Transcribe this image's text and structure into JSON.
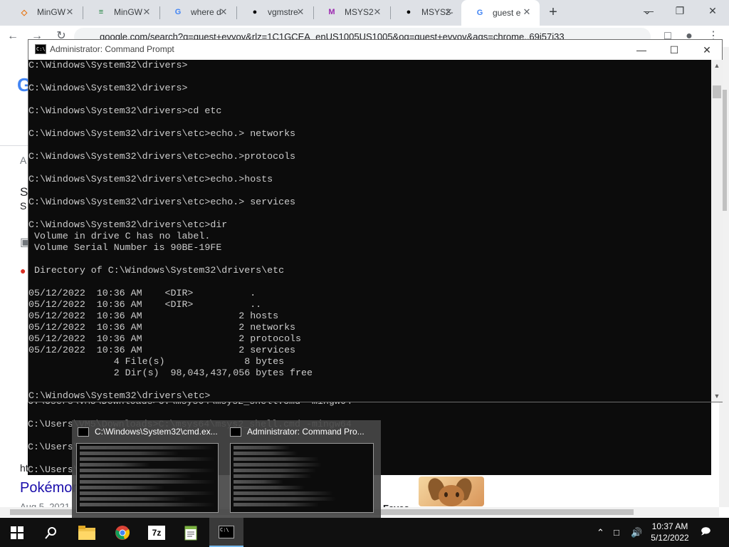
{
  "browser": {
    "tabs": [
      {
        "label": "MinGW",
        "icon": "sourceforge-icon",
        "color": "#e8710a"
      },
      {
        "label": "MinGW",
        "icon": "mingw-icon",
        "color": "#188038"
      },
      {
        "label": "where d",
        "icon": "google-icon",
        "color": "#4285f4"
      },
      {
        "label": "vgmstre",
        "icon": "github-icon",
        "color": "#000000"
      },
      {
        "label": "MSYS2",
        "icon": "msys2-icon",
        "color": "#9c27b0"
      },
      {
        "label": "MSYS2-",
        "icon": "github-icon",
        "color": "#000000"
      },
      {
        "label": "guest e",
        "icon": "google-icon",
        "color": "#4285f4",
        "active": true
      }
    ],
    "new_tab": "+",
    "url": "google.com/search?q=guest+evyov&rlz=1C1GCEA_enUS1005US1005&oq=guest+evyov&aqs=chrome..69i57j33"
  },
  "cmd_window": {
    "title": "Administrator: Command Prompt",
    "lines": [
      "C:\\Windows\\System32\\drivers>",
      "",
      "C:\\Windows\\System32\\drivers>",
      "",
      "C:\\Windows\\System32\\drivers>cd etc",
      "",
      "C:\\Windows\\System32\\drivers\\etc>echo.> networks",
      "",
      "C:\\Windows\\System32\\drivers\\etc>echo.>protocols",
      "",
      "C:\\Windows\\System32\\drivers\\etc>echo.>hosts",
      "",
      "C:\\Windows\\System32\\drivers\\etc>echo.> services",
      "",
      "C:\\Windows\\System32\\drivers\\etc>dir",
      " Volume in drive C has no label.",
      " Volume Serial Number is 90BE-19FE",
      "",
      " Directory of C:\\Windows\\System32\\drivers\\etc",
      "",
      "05/12/2022  10:36 AM    <DIR>          .",
      "05/12/2022  10:36 AM    <DIR>          ..",
      "05/12/2022  10:36 AM                 2 hosts",
      "05/12/2022  10:36 AM                 2 networks",
      "05/12/2022  10:36 AM                 2 protocols",
      "05/12/2022  10:36 AM                 2 services",
      "               4 File(s)              8 bytes",
      "               2 Dir(s)  98,043,437,056 bytes free",
      "",
      "C:\\Windows\\System32\\drivers\\etc>"
    ]
  },
  "background_cmd": {
    "lines": [
      "C:\\Users\\VM5\\Downloads>C:\\msys64\\msys2_shell.cmd -mingw64",
      "",
      "C:\\Users\\VM5\\Downloads>C:\\msys64\\msys2_shell.cmd -mingw64",
      "",
      "C:\\Users\\",
      "",
      "C:\\Users\\"
    ]
  },
  "google_page": {
    "result_title": "Pokémon",
    "result_date": "Aug 5, 2021",
    "faves_label": "Faves",
    "peek_letters": [
      "A",
      "S",
      "S",
      "htt"
    ]
  },
  "taskbar_preview": {
    "items": [
      {
        "title": "C:\\Windows\\System32\\cmd.ex..."
      },
      {
        "title": "Administrator: Command Pro..."
      }
    ]
  },
  "taskbar": {
    "apps": [
      "start-icon",
      "search-icon",
      "file-explorer-icon",
      "chrome-icon",
      "7zip-icon",
      "notepad-plus-icon",
      "cmd-icon"
    ],
    "clock_time": "10:37 AM",
    "clock_date": "5/12/2022"
  }
}
